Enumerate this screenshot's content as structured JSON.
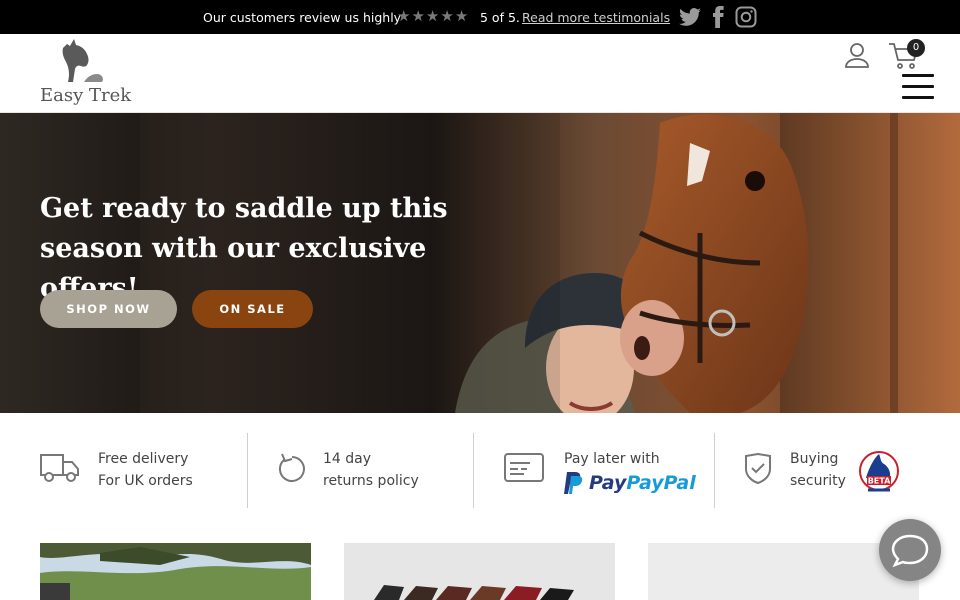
{
  "topbar": {
    "message": "Our customers review us highly",
    "rating_stars": 5,
    "score": "5 of 5.",
    "more_link": "Read more testimonials",
    "social": [
      "twitter-icon",
      "facebook-icon",
      "instagram-icon"
    ]
  },
  "header": {
    "brand": "Easy Trek",
    "cart_count": "0",
    "icons": [
      "account-icon",
      "cart-icon",
      "menu-icon"
    ]
  },
  "hero": {
    "title": "Get ready to saddle up this season with our exclusive offers!",
    "shop_button": "SHOP NOW",
    "sale_button": "ON SALE"
  },
  "features": [
    {
      "line1": "Free delivery",
      "line2": "For UK orders",
      "icon": "delivery-truck-icon"
    },
    {
      "line1": "14 day",
      "line2": "returns policy",
      "icon": "returns-icon"
    },
    {
      "line1": "Pay later with",
      "line2": "PayPal",
      "icon": "credit-card-icon"
    },
    {
      "line1": "Buying",
      "line2": "security",
      "icon": "shield-check-icon",
      "badge": "BETA"
    }
  ],
  "colors": {
    "topbar_bg": "#000000",
    "shop_button": "#a8a295",
    "sale_button": "#8a4410",
    "paypal_dark": "#253b80",
    "paypal_light": "#179bd7"
  }
}
